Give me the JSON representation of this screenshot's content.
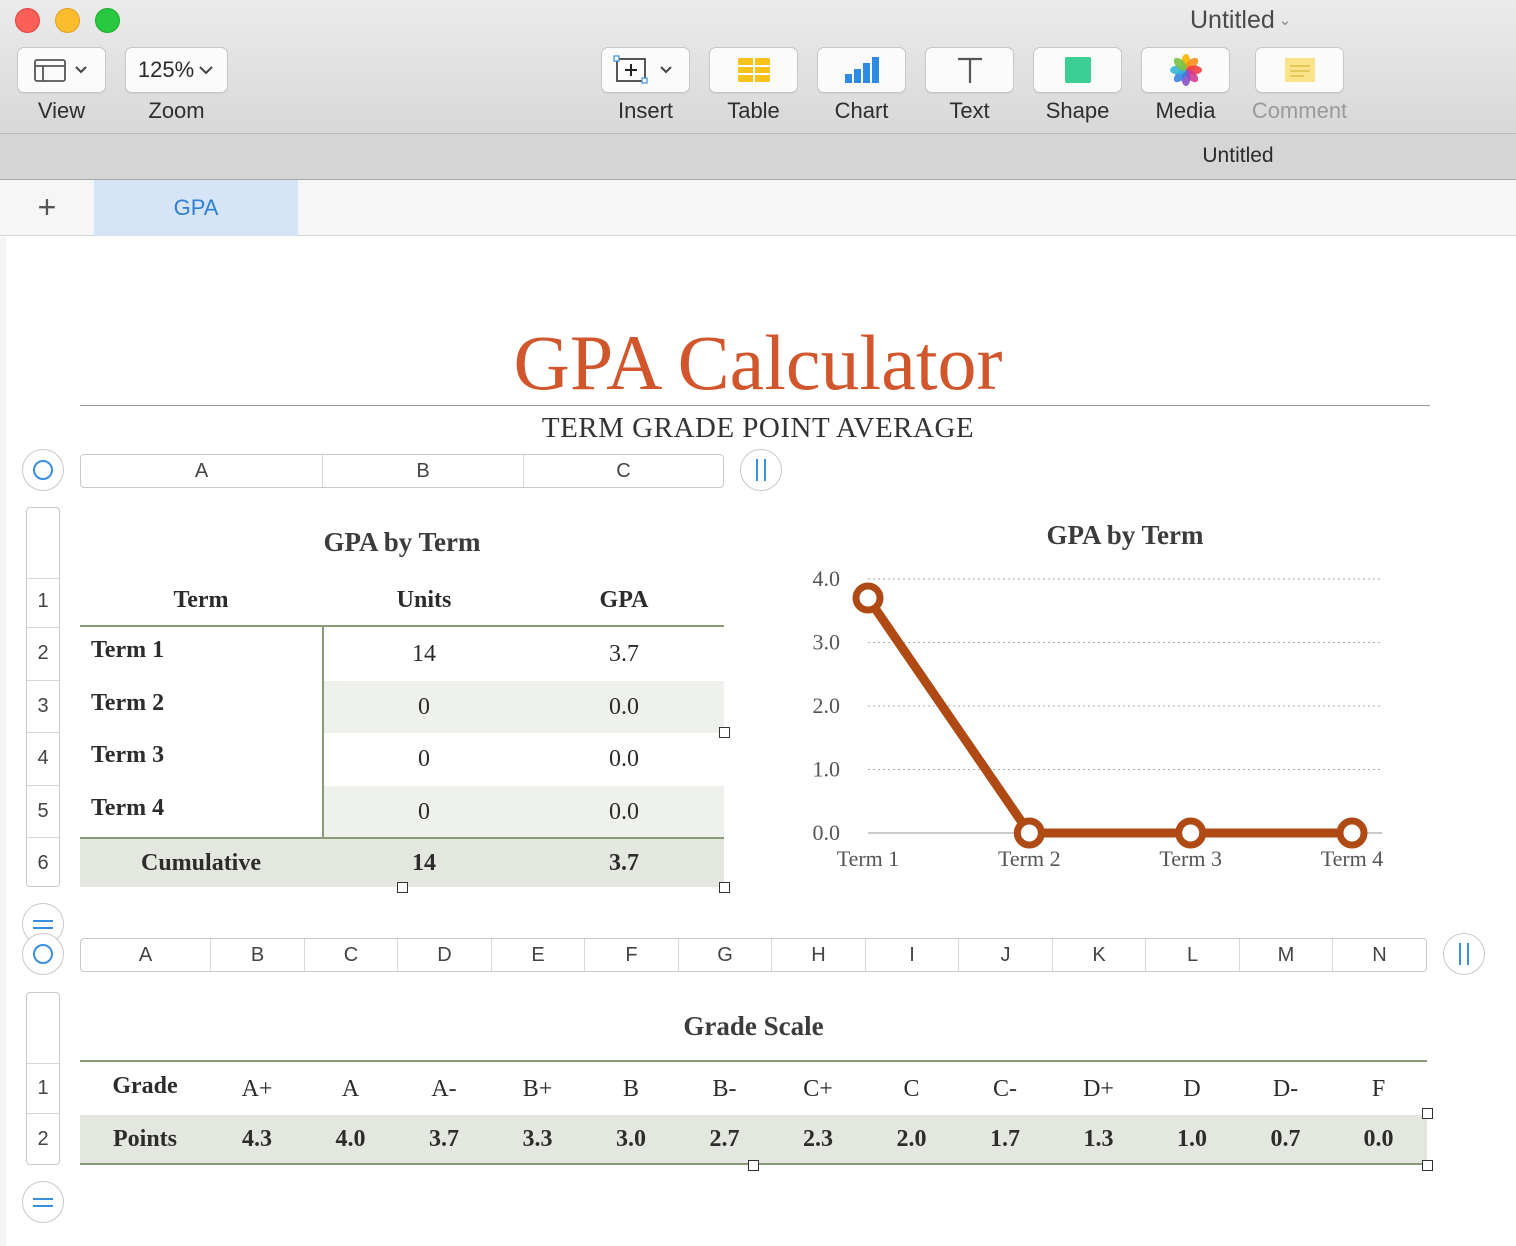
{
  "window": {
    "title": "Untitled",
    "subtitle": "Untitled"
  },
  "toolbar": {
    "view_label": "View",
    "zoom_value": "125%",
    "zoom_label": "Zoom",
    "insert_label": "Insert",
    "table_label": "Table",
    "chart_label": "Chart",
    "text_label": "Text",
    "shape_label": "Shape",
    "media_label": "Media",
    "comment_label": "Comment"
  },
  "tabs": [
    {
      "label": "GPA",
      "active": true
    }
  ],
  "document": {
    "title": "GPA Calculator",
    "subtitle": "TERM GRADE POINT AVERAGE"
  },
  "gpa_table": {
    "title": "GPA by Term",
    "column_letters": [
      "A",
      "B",
      "C"
    ],
    "row_numbers": [
      "1",
      "2",
      "3",
      "4",
      "5",
      "6"
    ],
    "headers": [
      "Term",
      "Units",
      "GPA"
    ],
    "rows": [
      {
        "term": "Term 1",
        "units": "14",
        "gpa": "3.7"
      },
      {
        "term": "Term 2",
        "units": "0",
        "gpa": "0.0"
      },
      {
        "term": "Term 3",
        "units": "0",
        "gpa": "0.0"
      },
      {
        "term": "Term 4",
        "units": "0",
        "gpa": "0.0"
      }
    ],
    "footer": {
      "label": "Cumulative",
      "units": "14",
      "gpa": "3.7"
    }
  },
  "chart_data": {
    "type": "line",
    "title": "GPA by Term",
    "categories": [
      "Term 1",
      "Term 2",
      "Term 3",
      "Term 4"
    ],
    "series": [
      {
        "values": [
          3.7,
          0.0,
          0.0,
          0.0
        ]
      }
    ],
    "ylim": [
      0,
      4
    ],
    "yticks": [
      "0.0",
      "1.0",
      "2.0",
      "3.0",
      "4.0"
    ],
    "grid": true,
    "line_color": "#b04a14"
  },
  "grade_table": {
    "title": "Grade Scale",
    "column_letters": [
      "A",
      "B",
      "C",
      "D",
      "E",
      "F",
      "G",
      "H",
      "I",
      "J",
      "K",
      "L",
      "M",
      "N"
    ],
    "row_numbers": [
      "1",
      "2"
    ],
    "grade_label": "Grade",
    "points_label": "Points",
    "grades": [
      "A+",
      "A",
      "A-",
      "B+",
      "B",
      "B-",
      "C+",
      "C",
      "C-",
      "D+",
      "D",
      "D-",
      "F"
    ],
    "points": [
      "4.3",
      "4.0",
      "3.7",
      "3.3",
      "3.0",
      "2.7",
      "2.3",
      "2.0",
      "1.7",
      "1.3",
      "1.0",
      "0.7",
      "0.0"
    ]
  },
  "colors": {
    "accent_title": "#d2562c",
    "tab_active_bg": "#d5e5f7",
    "tab_active_text": "#2f7fd6",
    "table_rule": "#8a9a78"
  }
}
